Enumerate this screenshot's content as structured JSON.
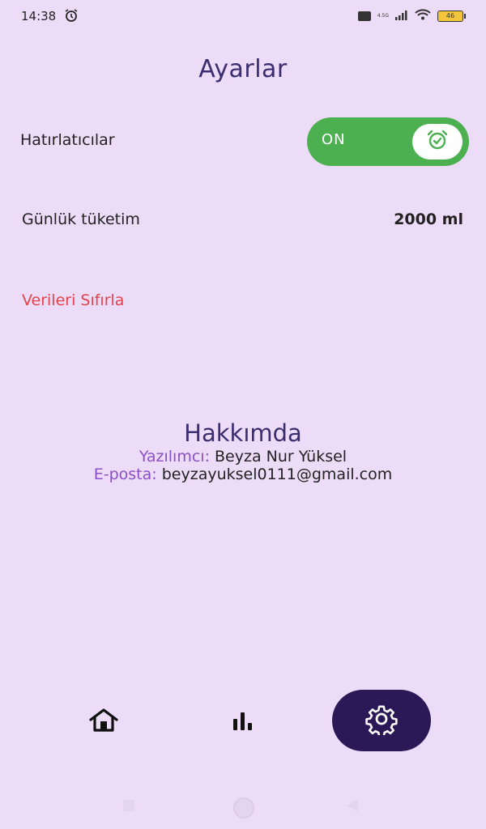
{
  "status_bar": {
    "time": "14:38",
    "network": "4.5G",
    "battery": "46"
  },
  "page": {
    "title": "Ayarlar"
  },
  "settings": {
    "reminders_label": "Hatırlatıcılar",
    "reminders_toggle_text": "ON",
    "reminders_enabled": true,
    "daily_consumption_label": "Günlük tüketim",
    "daily_consumption_value": "2000 ml",
    "reset_data_label": "Verileri Sıfırla"
  },
  "about": {
    "title": "Hakkımda",
    "developer_label": "Yazılımcı:",
    "developer_name": "Beyza Nur Yüksel",
    "email_label": "E-posta:",
    "email": "beyzayuksel0111@gmail.com"
  },
  "nav": {
    "items": [
      {
        "icon": "home-icon",
        "active": false
      },
      {
        "icon": "bar-chart-icon",
        "active": false
      },
      {
        "icon": "gear-icon",
        "active": true
      }
    ]
  },
  "colors": {
    "background": "#eddcf7",
    "title": "#3a2d70",
    "toggle_on": "#4caf50",
    "reset": "#e0434c",
    "nav_active": "#2b1857",
    "label_accent": "#8a4fc8"
  }
}
